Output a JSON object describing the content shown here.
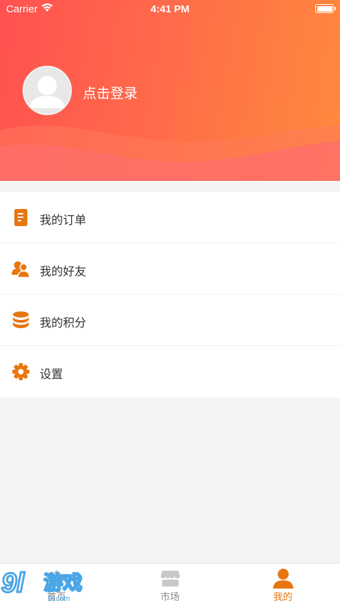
{
  "status_bar": {
    "carrier": "Carrier",
    "time": "4:41 PM"
  },
  "header": {
    "login_text": "点击登录"
  },
  "menu": {
    "items": [
      {
        "label": "我的订单",
        "icon": "order-icon"
      },
      {
        "label": "我的好友",
        "icon": "friends-icon"
      },
      {
        "label": "我的积分",
        "icon": "coins-icon"
      },
      {
        "label": "设置",
        "icon": "settings-icon"
      }
    ]
  },
  "tab_bar": {
    "tabs": [
      {
        "label": "首页",
        "icon": "home-icon",
        "active": false
      },
      {
        "label": "市场",
        "icon": "store-icon",
        "active": false
      },
      {
        "label": "我的",
        "icon": "user-icon",
        "active": true
      }
    ]
  },
  "watermark": {
    "number": "9l",
    "text": "游戏",
    "domain": "9l.com"
  },
  "colors": {
    "header_start": "#ff5151",
    "header_end": "#ff8a3c",
    "accent": "#e8760f",
    "background": "#f4f4f4"
  }
}
